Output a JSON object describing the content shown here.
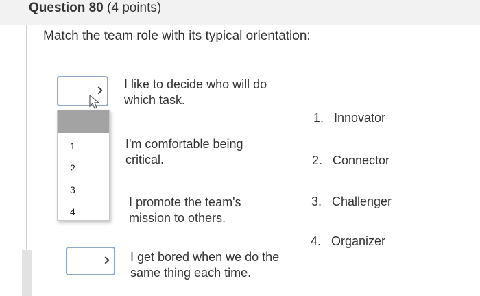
{
  "question": {
    "number_label": "Question 80",
    "points_label": "(4 points)",
    "prompt": "Match the team role with its typical orientation:"
  },
  "dropdown": {
    "options": [
      "",
      "1",
      "2",
      "3",
      "4"
    ]
  },
  "items": [
    {
      "line1": "I like to decide who will do",
      "line2": "which task."
    },
    {
      "line1": "I'm comfortable being",
      "line2": "critical."
    },
    {
      "line1": "I promote the team's",
      "line2": "mission to others."
    },
    {
      "line1": "I get bored when we do the",
      "line2": "same thing each time."
    }
  ],
  "answers": [
    {
      "number": "1.",
      "label": "Innovator"
    },
    {
      "number": "2.",
      "label": "Connector"
    },
    {
      "number": "3.",
      "label": "Challenger"
    },
    {
      "number": "4.",
      "label": "Organizer"
    }
  ],
  "colors": {
    "select_border": "#8fa7c2",
    "highlight_option": "#a3a3a3",
    "header_bg": "#f2f2f2"
  }
}
